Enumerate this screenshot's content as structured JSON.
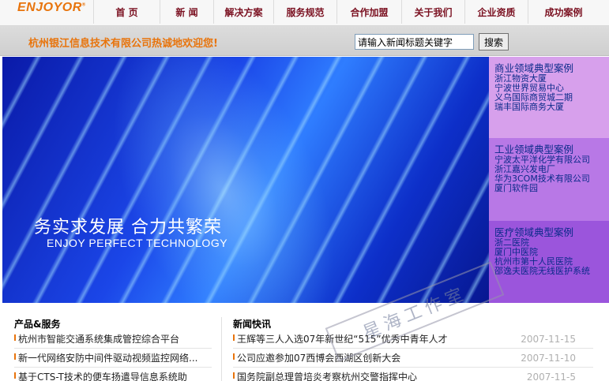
{
  "brand": {
    "logo_text": "ENJOYOR",
    "logo_mark": "®"
  },
  "nav": [
    {
      "label": "首 页"
    },
    {
      "label": "新 闻"
    },
    {
      "label": "解决方案"
    },
    {
      "label": "服务规范"
    },
    {
      "label": "合作加盟"
    },
    {
      "label": "关于我们"
    },
    {
      "label": "企业资质"
    },
    {
      "label": "成功案例"
    }
  ],
  "header": {
    "welcome": "杭州银江信息技术有限公司热诚地欢迎您!",
    "search_placeholder": "请输入新闻标题关键字",
    "search_button": "搜索"
  },
  "banner": {
    "slogan_cn": "务实求发展  合力共繁荣",
    "slogan_en": "ENJOY PERFECT TECHNOLOGY"
  },
  "cases": {
    "business": {
      "title": "商业领域典型案例",
      "items": [
        "浙江物资大厦",
        "宁波世界贸易中心",
        "义乌国际商贸城二期",
        "瑞丰国际商务大厦"
      ],
      "color": "#d7a0ec"
    },
    "industry": {
      "title": "工业领域典型案例",
      "items": [
        "宁波太平洋化学有限公司",
        "浙江嘉兴发电厂",
        "华为3COM技术有限公司",
        "厦门软件园"
      ],
      "color": "#b878e6"
    },
    "medical": {
      "title": "医疗领域典型案例",
      "items": [
        "浙二医院",
        "厦门中医院",
        "杭州市第十人民医院",
        "邵逸夫医院无线医护系统"
      ],
      "color": "#9b55dc"
    }
  },
  "products": {
    "title": "产品&服务",
    "items": [
      "杭州市智能交通系统集成管控综合平台",
      "新一代网络安防中间件驱动视频监控网络...",
      "基于CTS-T技术的便车扬遣导信息系统助"
    ]
  },
  "news": {
    "title": "新闻快讯",
    "items": [
      {
        "title": "王辉等三人入选07年新世纪“515”优秀中青年人才",
        "date": "2007-11-15"
      },
      {
        "title": "公司应邀参加07西博会西湖区创新大会",
        "date": "2007-11-10"
      },
      {
        "title": "国务院副总理曾培炎考察杭州交警指挥中心",
        "date": "2007-11-5"
      }
    ]
  },
  "watermark": "星海工作室",
  "colors": {
    "accent_orange": "#e8740c",
    "nav_text": "#7a1020",
    "case_text": "#0b2a8a"
  }
}
